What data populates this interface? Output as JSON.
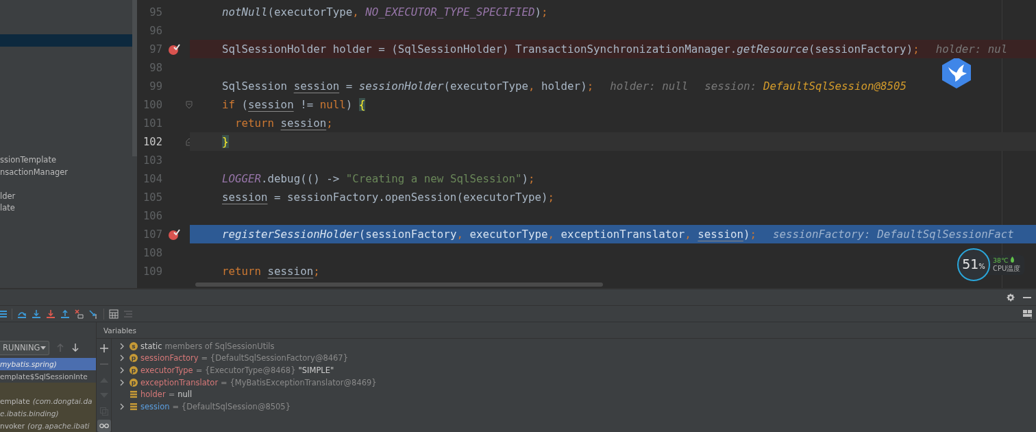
{
  "project_panel": {
    "items": [
      {
        "selected": true
      },
      {
        "selected": false
      },
      {
        "selected": false
      },
      {
        "selected": false
      },
      {
        "selected": false
      },
      {
        "selected": false
      },
      {
        "selected": false
      },
      {
        "selected": false
      },
      {
        "selected": false
      },
      {
        "selected": false
      },
      {
        "label": "ssionTemplate",
        "selected": false
      },
      {
        "label": "nsactionManager",
        "selected": false
      },
      {
        "selected": false
      },
      {
        "label": "lder",
        "selected": false
      },
      {
        "label": "late",
        "selected": false
      }
    ]
  },
  "editor": {
    "lines": [
      {
        "number": "95",
        "kind": "plain",
        "breakpoint": false,
        "execution": false,
        "caret": false,
        "tokens": [
          {
            "kind": "italic",
            "text": "notNull"
          },
          {
            "kind": "plain",
            "text": "(executorType"
          },
          {
            "kind": "punct",
            "text": ", "
          },
          {
            "kind": "const",
            "text": "NO_EXECUTOR_TYPE_SPECIFIED"
          },
          {
            "kind": "plain",
            "text": ")"
          },
          {
            "kind": "punct",
            "text": ";"
          }
        ]
      },
      {
        "number": "96",
        "kind": "plain",
        "breakpoint": false,
        "execution": false,
        "caret": false
      },
      {
        "number": "97",
        "kind": "plain",
        "breakpoint": true,
        "execution": false,
        "caret": false,
        "tokens": [
          {
            "kind": "plain",
            "text": "SqlSessionHolder holder = (SqlSessionHolder) TransactionSynchronizationManager."
          },
          {
            "kind": "italic",
            "text": "getResource"
          },
          {
            "kind": "plain",
            "text": "(sessionFactory)"
          },
          {
            "kind": "punct",
            "text": ";"
          },
          {
            "kind": "hint",
            "text": "holder: nul"
          }
        ]
      },
      {
        "number": "98",
        "kind": "plain",
        "breakpoint": false,
        "execution": false,
        "caret": false
      },
      {
        "number": "99",
        "kind": "plain",
        "breakpoint": false,
        "execution": false,
        "caret": false,
        "tokens": [
          {
            "kind": "plain",
            "text": "SqlSession "
          },
          {
            "kind": "var",
            "text": "session"
          },
          {
            "kind": "plain",
            "text": " = "
          },
          {
            "kind": "italic",
            "text": "sessionHolder"
          },
          {
            "kind": "plain",
            "text": "(executorType"
          },
          {
            "kind": "punct",
            "text": ", "
          },
          {
            "kind": "plain",
            "text": "holder)"
          },
          {
            "kind": "punct",
            "text": ";"
          },
          {
            "kind": "hint",
            "text": "holder: null"
          },
          {
            "kind": "hint",
            "text": "session:"
          },
          {
            "kind": "hintval",
            "text": "DefaultSqlSession@8505"
          }
        ]
      },
      {
        "number": "100",
        "kind": "open",
        "breakpoint": false,
        "execution": false,
        "caret": false,
        "tokens": [
          {
            "kind": "kw",
            "text": "if"
          },
          {
            "kind": "plain",
            "text": " ("
          },
          {
            "kind": "var",
            "text": "session"
          },
          {
            "kind": "plain",
            "text": " != "
          },
          {
            "kind": "kw",
            "text": "null"
          },
          {
            "kind": "plain",
            "text": ") "
          },
          {
            "kind": "brace",
            "text": "{"
          }
        ]
      },
      {
        "number": "101",
        "kind": "plain",
        "breakpoint": false,
        "execution": false,
        "caret": false,
        "indented": true,
        "tokens": [
          {
            "kind": "kw",
            "text": "return "
          },
          {
            "kind": "var",
            "text": "session"
          },
          {
            "kind": "punct",
            "text": ";"
          }
        ]
      },
      {
        "number": "102",
        "kind": "close",
        "breakpoint": false,
        "execution": false,
        "caret": true,
        "tokens": [
          {
            "kind": "brace",
            "text": "}"
          }
        ]
      },
      {
        "number": "103",
        "kind": "plain",
        "breakpoint": false,
        "execution": false,
        "caret": false
      },
      {
        "number": "104",
        "kind": "plain",
        "breakpoint": false,
        "execution": false,
        "caret": false,
        "tokens": [
          {
            "kind": "static",
            "text": "LOGGER"
          },
          {
            "kind": "plain",
            "text": ".debug(() -> "
          },
          {
            "kind": "str",
            "text": "\"Creating a new SqlSession\""
          },
          {
            "kind": "plain",
            "text": ")"
          },
          {
            "kind": "punct",
            "text": ";"
          }
        ]
      },
      {
        "number": "105",
        "kind": "plain",
        "breakpoint": false,
        "execution": false,
        "caret": false,
        "tokens": [
          {
            "kind": "var",
            "text": "session"
          },
          {
            "kind": "plain",
            "text": " = sessionFactory.openSession(executorType)"
          },
          {
            "kind": "punct",
            "text": ";"
          }
        ]
      },
      {
        "number": "106",
        "kind": "plain",
        "breakpoint": false,
        "execution": false,
        "caret": false
      },
      {
        "number": "107",
        "kind": "plain",
        "breakpoint": true,
        "execution": true,
        "caret": false,
        "tokens": [
          {
            "kind": "italic",
            "text": "registerSessionHolder"
          },
          {
            "kind": "plain",
            "text": "(sessionFactory"
          },
          {
            "kind": "punct",
            "text": ", "
          },
          {
            "kind": "plain",
            "text": "executorType"
          },
          {
            "kind": "punct",
            "text": ", "
          },
          {
            "kind": "plain",
            "text": "exceptionTranslator"
          },
          {
            "kind": "punct",
            "text": ", "
          },
          {
            "kind": "var",
            "text": "session"
          },
          {
            "kind": "plain",
            "text": ")"
          },
          {
            "kind": "punct",
            "text": ";"
          },
          {
            "kind": "hint",
            "text": "sessionFactory:"
          },
          {
            "kind": "hintval",
            "text": "DefaultSqlSessionFact"
          }
        ]
      },
      {
        "number": "108",
        "kind": "plain",
        "breakpoint": false,
        "execution": false,
        "caret": false
      },
      {
        "number": "109",
        "kind": "plain",
        "breakpoint": false,
        "execution": false,
        "caret": false,
        "tokens": [
          {
            "kind": "kw",
            "text": "return "
          },
          {
            "kind": "var",
            "text": "session"
          },
          {
            "kind": "punct",
            "text": ";"
          }
        ]
      }
    ]
  },
  "frames": {
    "thread_filter": "RUNNING",
    "rows": [
      {
        "kind": "project",
        "selected": true,
        "package": "mybatis.spring)"
      },
      {
        "kind": "project",
        "selected": false,
        "name": "emplate$SqlSessionInte"
      },
      {
        "kind": "library",
        "selected": false
      },
      {
        "kind": "library",
        "selected": false,
        "name": "emplate",
        "package": "(com.dongtai.da"
      },
      {
        "kind": "library",
        "selected": false,
        "package": "e.ibatis.binding)"
      },
      {
        "kind": "library",
        "selected": false,
        "name": "nvoker",
        "package": "(org.apache.ibati"
      }
    ]
  },
  "variables": {
    "title": "Variables",
    "rows": [
      {
        "expandable": true,
        "kind": "static",
        "icon_letter": "s",
        "name": "static",
        "value": "members of SqlSessionUtils",
        "changed": false
      },
      {
        "expandable": true,
        "kind": "field",
        "icon_letter": "p",
        "name": "sessionFactory",
        "value": "= {DefaultSqlSessionFactory@8467}",
        "changed": false
      },
      {
        "expandable": true,
        "kind": "field",
        "icon_letter": "p",
        "name": "executorType",
        "value": "= {ExecutorType@8468}",
        "extra": "\"SIMPLE\"",
        "changed": false
      },
      {
        "expandable": true,
        "kind": "field",
        "icon_letter": "p",
        "name": "exceptionTranslator",
        "value": "= {MyBatisExceptionTranslator@8469}",
        "changed": false
      },
      {
        "expandable": false,
        "kind": "local",
        "name": "holder",
        "value": "=",
        "extra": "null",
        "changed": false
      },
      {
        "expandable": true,
        "kind": "local",
        "name": "session",
        "value": "= {DefaultSqlSession@8505}",
        "changed": true
      }
    ]
  },
  "cpu_widget": {
    "usage": "51",
    "unit": "%",
    "temperature": "38℃",
    "label": "CPU温度"
  }
}
